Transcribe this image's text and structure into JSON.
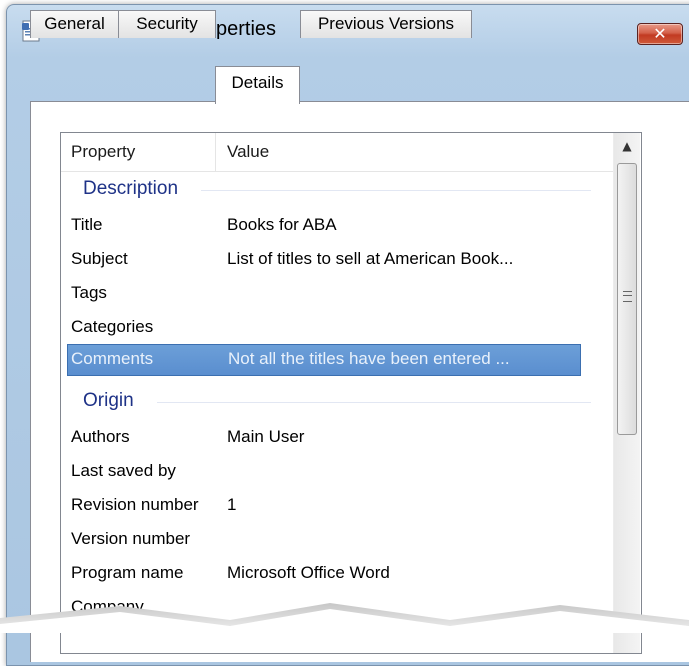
{
  "window": {
    "title": "Word file.docx Properties",
    "close_glyph": "✕",
    "icon": "document-properties-icon"
  },
  "tabs": [
    {
      "label": "General",
      "active": false
    },
    {
      "label": "Security",
      "active": false
    },
    {
      "label": "Details",
      "active": true
    },
    {
      "label": "Previous Versions",
      "active": false
    }
  ],
  "list": {
    "columns": {
      "property": "Property",
      "value": "Value"
    },
    "groups": [
      {
        "title": "Description",
        "rows": [
          {
            "property": "Title",
            "value": "Books for ABA"
          },
          {
            "property": "Subject",
            "value": "List of titles to sell at American Book..."
          },
          {
            "property": "Tags",
            "value": ""
          },
          {
            "property": "Categories",
            "value": ""
          },
          {
            "property": "Comments",
            "value": "Not all the titles have been entered ...",
            "selected": true
          }
        ]
      },
      {
        "title": "Origin",
        "rows": [
          {
            "property": "Authors",
            "value": "Main User"
          },
          {
            "property": "Last saved by",
            "value": ""
          },
          {
            "property": "Revision number",
            "value": "1"
          },
          {
            "property": "Version number",
            "value": ""
          },
          {
            "property": "Program name",
            "value": "Microsoft Office Word"
          },
          {
            "property": "Company",
            "value": ""
          }
        ]
      }
    ]
  },
  "scrollbar": {
    "up_glyph": "▲"
  },
  "colors": {
    "selection": "#5a8ecf",
    "group_heading": "#1e3287",
    "close_button": "#c23a22"
  }
}
